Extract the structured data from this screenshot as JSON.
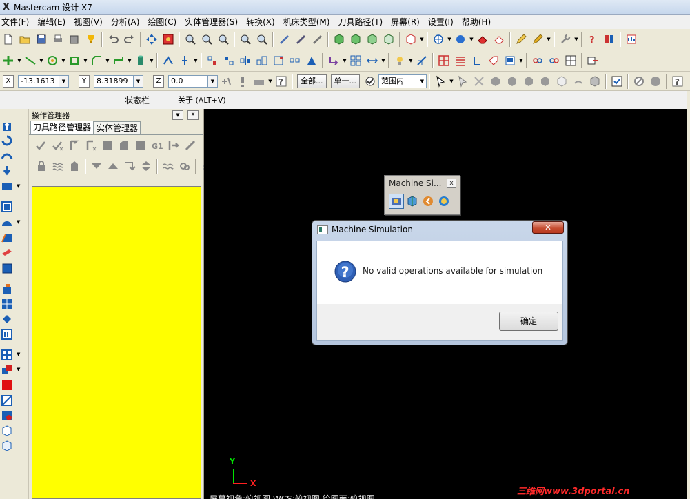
{
  "window": {
    "app_logo": "X",
    "title": "Mastercam 设计  X7"
  },
  "menu": [
    "文件(F)",
    "编辑(E)",
    "视图(V)",
    "分析(A)",
    "绘图(C)",
    "实体管理器(S)",
    "转换(X)",
    "机床类型(M)",
    "刀具路径(T)",
    "屏幕(R)",
    "设置(I)",
    "帮助(H)"
  ],
  "coords": {
    "x_label": "X",
    "x_value": "-13.1613",
    "y_label": "Y",
    "y_value": "8.31899",
    "z_label": "Z",
    "z_value": "0.0"
  },
  "selection": {
    "all_button": "全部...",
    "single_button": "单一...",
    "mode_select": "范围内"
  },
  "status_strip": {
    "status_label": "状态栏",
    "about_label": "关于 (ALT+V)"
  },
  "ops_manager": {
    "title": "操作管理器",
    "pin_glyph": "▼",
    "close_glyph": "X",
    "tabs": [
      "刀具路径管理器",
      "实体管理器"
    ],
    "active_tab": 0,
    "tree_color": "#ffff00"
  },
  "viewport": {
    "axis_y_label": "Y",
    "axis_x_label": "X",
    "view_status": "屏幕视角:俯视图    WCS:俯视图    绘图面:俯视图"
  },
  "machine_sim_toolbar": {
    "title": "Machine Si...",
    "close_glyph": "x"
  },
  "dialog": {
    "title": "Machine Simulation",
    "close_glyph": "✕",
    "message": "No valid operations available for simulation",
    "ok_button": "确定"
  },
  "watermark": "三维网www.3dportal.cn",
  "icons": {
    "toolbar_row1": [
      "new-file-icon",
      "open-folder-icon",
      "save-icon",
      "print-icon",
      "save-as-icon",
      "trophy-icon",
      "undo-icon",
      "redo-icon",
      "move-icon",
      "fit-icon",
      "zoom-window-icon",
      "zoom-in-icon",
      "zoom-out-icon",
      "unzoom-icon",
      "shade-icon",
      "wireframe-icon",
      "hidden-line-icon",
      "cube-icon",
      "cube-green-icon",
      "cube-iso-icon",
      "cube-outline-icon",
      "view-cube-icon",
      "globe-icon",
      "sphere-icon",
      "eraser-icon",
      "erase-outline-icon",
      "pencil-icon",
      "pencil-multi-icon",
      "wrench-icon",
      "help-icon",
      "analyze-icon",
      "chart-icon"
    ]
  },
  "colors": {
    "viewport_bg": "#000000",
    "tree_bg": "#ffff00",
    "dialog_close_red": "#c44a2e",
    "watermark_red": "#ff2a2a"
  }
}
